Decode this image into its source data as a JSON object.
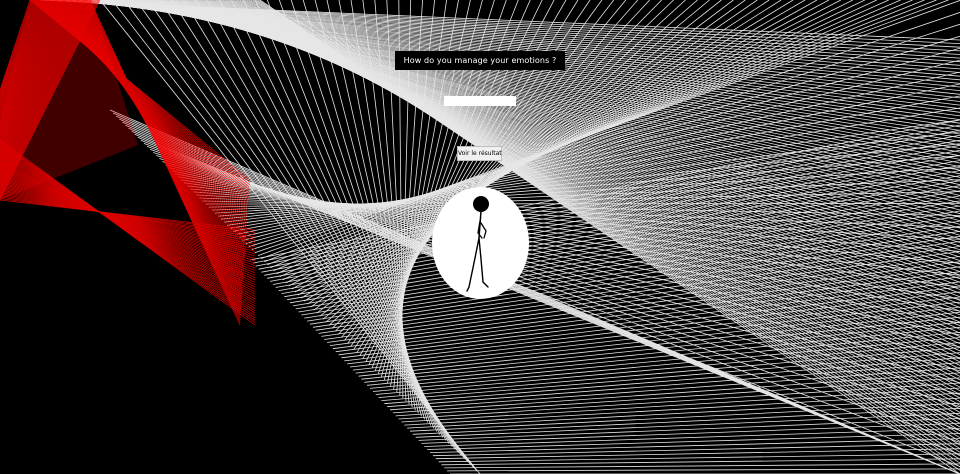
{
  "page": {
    "question": "How do you manage your emotions ?",
    "answer_value": "",
    "answer_placeholder": "",
    "result_button_label": "Voir le résultat"
  },
  "colors": {
    "background": "#000000",
    "line_white": "#ffffff",
    "line_red": "#ff0000",
    "banner_background": "#000000",
    "button_background": "#f0f0f0"
  },
  "icons": {
    "figure": "stick-figure-walking-icon"
  }
}
